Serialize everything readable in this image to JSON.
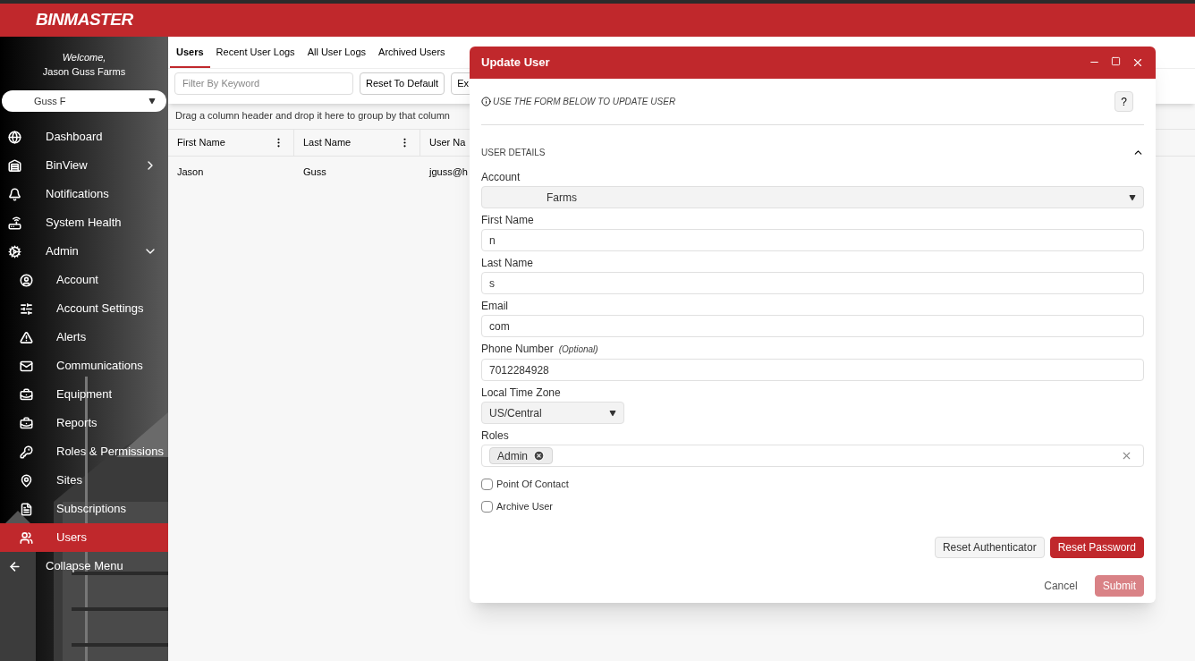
{
  "header": {
    "logo": "BINMASTER"
  },
  "sidebar": {
    "welcome": "Welcome,",
    "account_name": "Jason Guss Farms",
    "account_select": "Guss F",
    "items": [
      {
        "kind": "main",
        "label": "Dashboard",
        "selected": false
      },
      {
        "kind": "main",
        "label": "BinView",
        "selected": false,
        "expanded": false
      },
      {
        "kind": "main",
        "label": "Notifications",
        "selected": false
      },
      {
        "kind": "main",
        "label": "System Health",
        "selected": false
      },
      {
        "kind": "main",
        "label": "Admin",
        "selected": false,
        "expanded": true
      },
      {
        "kind": "sub",
        "label": "Account",
        "selected": false
      },
      {
        "kind": "sub",
        "label": "Account Settings",
        "selected": false
      },
      {
        "kind": "sub",
        "label": "Alerts",
        "selected": false
      },
      {
        "kind": "sub",
        "label": "Communications",
        "selected": false
      },
      {
        "kind": "sub",
        "label": "Equipment",
        "selected": false
      },
      {
        "kind": "sub",
        "label": "Reports",
        "selected": false
      },
      {
        "kind": "sub",
        "label": "Roles & Permissions",
        "selected": false
      },
      {
        "kind": "sub",
        "label": "Sites",
        "selected": false
      },
      {
        "kind": "sub",
        "label": "Subscriptions",
        "selected": false
      },
      {
        "kind": "sub",
        "label": "Users",
        "selected": true
      },
      {
        "kind": "main",
        "label": "Collapse Menu",
        "selected": false
      }
    ]
  },
  "tabs": [
    {
      "label": "Users",
      "selected": true
    },
    {
      "label": "Recent User Logs",
      "selected": false
    },
    {
      "label": "All User Logs",
      "selected": false
    },
    {
      "label": "Archived Users",
      "selected": false
    }
  ],
  "toolbar": {
    "search_placeholder": "Filter By Keyword",
    "buttons": [
      "Reset To Default",
      "Ex"
    ]
  },
  "group_hint": "Drag a column header and drop it here to group by that column",
  "table": {
    "columns": [
      "First Name",
      "Last Name",
      "User Na"
    ],
    "rows": [
      [
        "Jason",
        "Guss",
        "jguss@h"
      ]
    ]
  },
  "dialog": {
    "title": "Update User",
    "info": "USE THE FORM BELOW TO UPDATE USER",
    "help": "?",
    "section": "USER DETAILS",
    "expanded": true,
    "fields": [
      {
        "kind": "select",
        "label": "Account",
        "value": "Farms"
      },
      {
        "kind": "text",
        "label": "First Name",
        "value": "n"
      },
      {
        "kind": "text",
        "label": "Last Name",
        "value": "s"
      },
      {
        "kind": "text",
        "label": "Email",
        "value": "com"
      },
      {
        "kind": "text",
        "label": "Phone Number",
        "note": "(Optional)",
        "value": "7012284928"
      },
      {
        "kind": "small-select",
        "label": "Local Time Zone",
        "value": "US/Central"
      },
      {
        "kind": "tags",
        "label": "Roles",
        "tags": [
          "Admin"
        ]
      }
    ],
    "checkboxes": [
      {
        "label": "Point Of Contact",
        "checked": false
      },
      {
        "label": "Archive User",
        "checked": false
      }
    ],
    "actions": [
      {
        "label": "Reset Authenticator",
        "kind": "secondary",
        "disabled": false
      },
      {
        "label": "Reset Password",
        "kind": "primary",
        "disabled": false
      }
    ],
    "footer": [
      {
        "label": "Cancel",
        "kind": "link",
        "disabled": false
      },
      {
        "label": "Submit",
        "kind": "primary",
        "disabled": true
      }
    ]
  }
}
